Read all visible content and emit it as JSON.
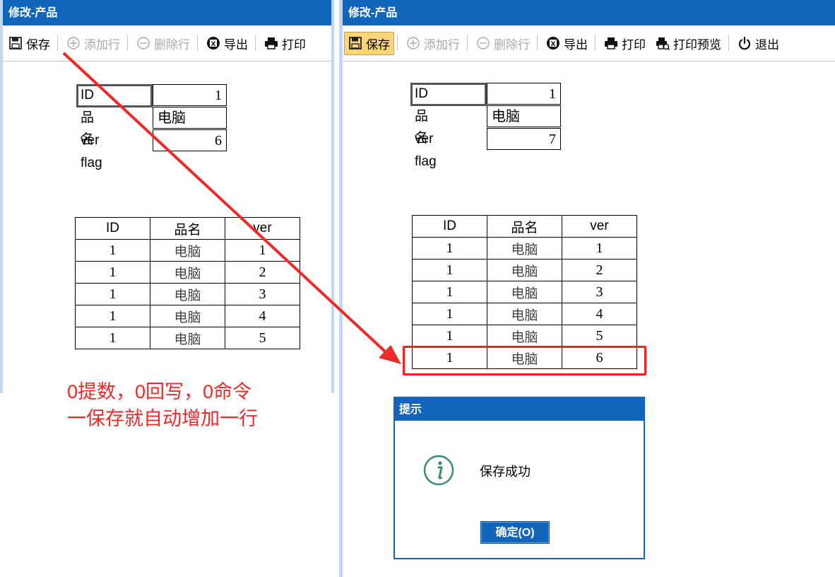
{
  "left": {
    "title": "修改-产品",
    "toolbar": {
      "save": "保存",
      "add_row": "添加行",
      "delete_row": "删除行",
      "export": "导出",
      "print": "打印"
    },
    "form": {
      "id_label": "ID",
      "id_value": "1",
      "name_label": "品名",
      "name_value": "电脑",
      "ver_label": "ver",
      "ver_value": "6",
      "flag_label": "flag"
    },
    "table": {
      "headers": [
        "ID",
        "品名",
        "ver"
      ],
      "rows": [
        [
          "1",
          "电脑",
          "1"
        ],
        [
          "1",
          "电脑",
          "2"
        ],
        [
          "1",
          "电脑",
          "3"
        ],
        [
          "1",
          "电脑",
          "4"
        ],
        [
          "1",
          "电脑",
          "5"
        ]
      ]
    }
  },
  "right": {
    "title": "修改-产品",
    "toolbar": {
      "save": "保存",
      "add_row": "添加行",
      "delete_row": "删除行",
      "export": "导出",
      "print": "打印",
      "print_preview": "打印预览",
      "exit": "退出"
    },
    "form": {
      "id_label": "ID",
      "id_value": "1",
      "name_label": "品名",
      "name_value": "电脑",
      "ver_label": "ver",
      "ver_value": "7",
      "flag_label": "flag"
    },
    "table": {
      "headers": [
        "ID",
        "品名",
        "ver"
      ],
      "rows": [
        [
          "1",
          "电脑",
          "1"
        ],
        [
          "1",
          "电脑",
          "2"
        ],
        [
          "1",
          "电脑",
          "3"
        ],
        [
          "1",
          "电脑",
          "4"
        ],
        [
          "1",
          "电脑",
          "5"
        ],
        [
          "1",
          "电脑",
          "6"
        ]
      ]
    }
  },
  "dialog": {
    "title": "提示",
    "message": "保存成功",
    "ok_label": "确定(O)"
  },
  "annotation": {
    "line1": "0提数，0回写，0命令",
    "line2": "一保存就自动增加一行"
  },
  "colors": {
    "titlebar": "#1166bb",
    "annotation": "#ee2a2a",
    "active_button": "#fcd47a"
  },
  "icons": [
    "save-icon",
    "add-circle-icon",
    "minus-circle-icon",
    "export-icon",
    "printer-icon",
    "print-preview-icon",
    "power-icon",
    "info-icon"
  ]
}
